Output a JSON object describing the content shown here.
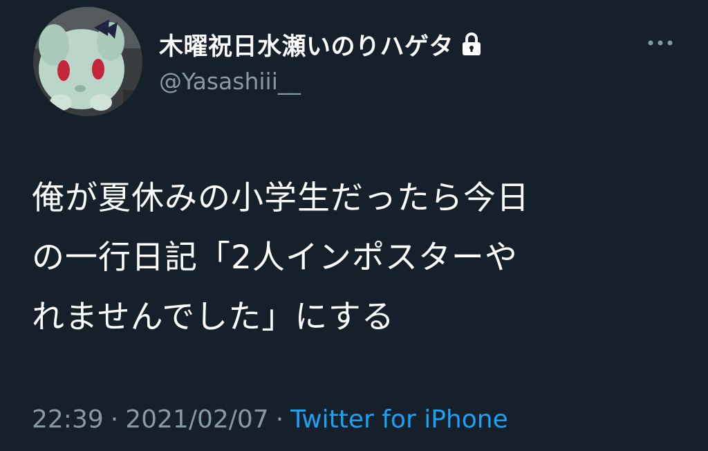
{
  "user": {
    "display_name": "木曜祝日水瀬いのりハゲタ",
    "handle": "@Yasashiii__",
    "protected_icon": "lock-icon",
    "avatar_icon": "avatar"
  },
  "tweet": {
    "lines": [
      "俺が夏休みの小学生だったら今日",
      "の一行日記「2人インポスターや",
      "れませんでした」にする"
    ]
  },
  "meta": {
    "time": "22:39",
    "separator": "·",
    "date": "2021/02/07",
    "source": "Twitter for iPhone"
  },
  "menu": {
    "icon": "more-icon"
  },
  "colors": {
    "background": "#15202b",
    "secondary_text": "#8899a6",
    "link": "#1da1f2",
    "primary_text": "#ffffff"
  }
}
